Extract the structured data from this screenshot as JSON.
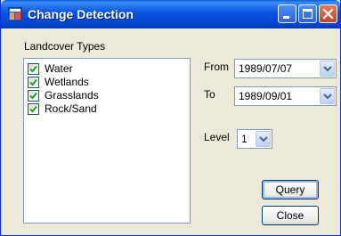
{
  "window": {
    "title": "Change Detection",
    "controls": [
      "minimize",
      "maximize",
      "close"
    ]
  },
  "landcover": {
    "label": "Landcover Types",
    "items": [
      {
        "label": "Water",
        "checked": true
      },
      {
        "label": "Wetlands",
        "checked": true
      },
      {
        "label": "Grasslands",
        "checked": true
      },
      {
        "label": "Rock/Sand",
        "checked": true
      }
    ]
  },
  "form": {
    "from_label": "From",
    "from_value": "1989/07/07",
    "to_label": "To",
    "to_value": "1989/09/01",
    "level_label": "Level",
    "level_value": "1"
  },
  "buttons": {
    "query": "Query",
    "close": "Close"
  },
  "icons": {
    "app": "app-window-icon",
    "minimize": "minimize-icon",
    "maximize": "maximize-icon",
    "close": "close-icon",
    "checkbox_checked": "checkmark-icon",
    "dropdown": "chevron-down-icon"
  }
}
